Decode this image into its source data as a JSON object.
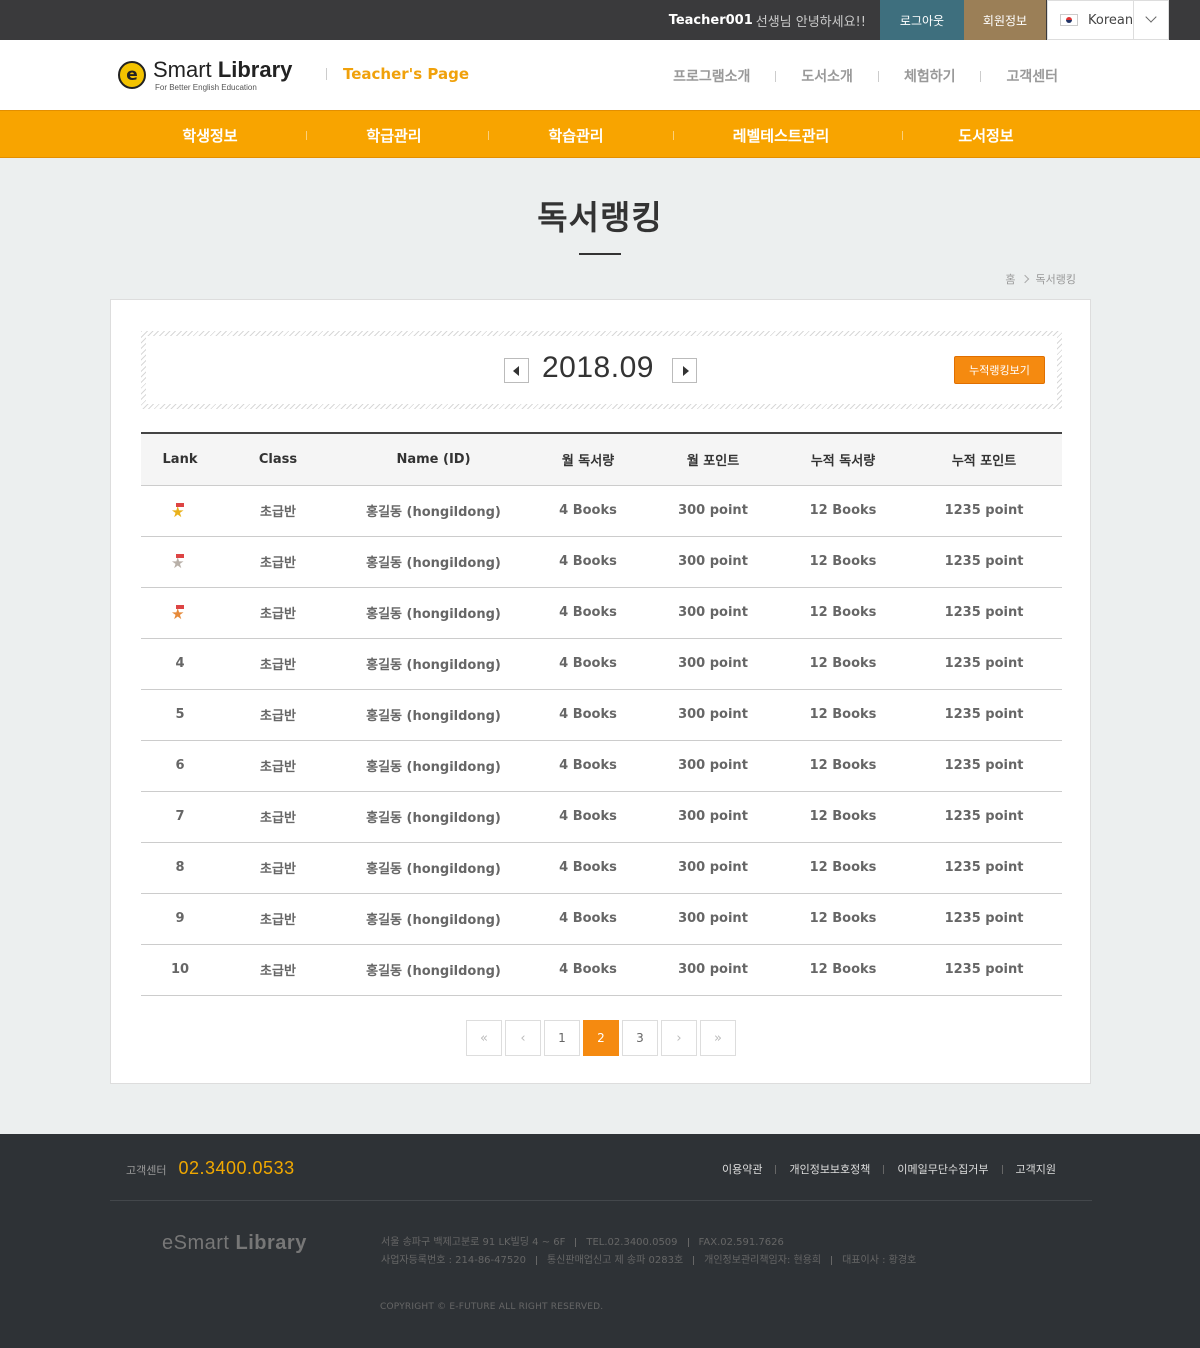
{
  "topbar": {
    "user": "Teacher001",
    "greeting": "선생님 안녕하세요!!",
    "logout": "로그아웃",
    "member_info": "회원정보",
    "language": "Korean"
  },
  "header": {
    "logo_letter": "e",
    "logo_title_light": "Smart",
    "logo_title_bold": "Library",
    "logo_sub": "For Better English Education",
    "teacher_page": "Teacher's Page",
    "gnav": [
      "프로그램소개",
      "도서소개",
      "체험하기",
      "고객센터"
    ]
  },
  "main_nav": [
    "학생정보",
    "학급관리",
    "학습관리",
    "레벨테스트관리",
    "도서정보"
  ],
  "page": {
    "title": "독서랭킹",
    "breadcrumb_home": "홈",
    "breadcrumb_current": "독서랭킹"
  },
  "ranking": {
    "year_month": "2018.09",
    "cumulative_button": "누적랭킹보기",
    "columns": [
      "Lank",
      "Class",
      "Name (ID)",
      "월 독서량",
      "월 포인트",
      "누적 독서량",
      "누적 포인트"
    ],
    "rows": [
      {
        "rank": "",
        "medal": "gold",
        "class": "초급반",
        "name": "홍길동 (hongildong)",
        "month_books": "4 Books",
        "month_points": "300 point",
        "total_books": "12 Books",
        "total_points": "1235 point"
      },
      {
        "rank": "",
        "medal": "silver",
        "class": "초급반",
        "name": "홍길동 (hongildong)",
        "month_books": "4 Books",
        "month_points": "300 point",
        "total_books": "12 Books",
        "total_points": "1235 point"
      },
      {
        "rank": "",
        "medal": "bronze",
        "class": "초급반",
        "name": "홍길동 (hongildong)",
        "month_books": "4 Books",
        "month_points": "300 point",
        "total_books": "12 Books",
        "total_points": "1235 point"
      },
      {
        "rank": "4",
        "medal": "",
        "class": "초급반",
        "name": "홍길동 (hongildong)",
        "month_books": "4 Books",
        "month_points": "300 point",
        "total_books": "12 Books",
        "total_points": "1235 point"
      },
      {
        "rank": "5",
        "medal": "",
        "class": "초급반",
        "name": "홍길동 (hongildong)",
        "month_books": "4 Books",
        "month_points": "300 point",
        "total_books": "12 Books",
        "total_points": "1235 point"
      },
      {
        "rank": "6",
        "medal": "",
        "class": "초급반",
        "name": "홍길동 (hongildong)",
        "month_books": "4 Books",
        "month_points": "300 point",
        "total_books": "12 Books",
        "total_points": "1235 point"
      },
      {
        "rank": "7",
        "medal": "",
        "class": "초급반",
        "name": "홍길동 (hongildong)",
        "month_books": "4 Books",
        "month_points": "300 point",
        "total_books": "12 Books",
        "total_points": "1235 point"
      },
      {
        "rank": "8",
        "medal": "",
        "class": "초급반",
        "name": "홍길동 (hongildong)",
        "month_books": "4 Books",
        "month_points": "300 point",
        "total_books": "12 Books",
        "total_points": "1235 point"
      },
      {
        "rank": "9",
        "medal": "",
        "class": "초급반",
        "name": "홍길동 (hongildong)",
        "month_books": "4 Books",
        "month_points": "300 point",
        "total_books": "12 Books",
        "total_points": "1235 point"
      },
      {
        "rank": "10",
        "medal": "",
        "class": "초급반",
        "name": "홍길동 (hongildong)",
        "month_books": "4 Books",
        "month_points": "300 point",
        "total_books": "12 Books",
        "total_points": "1235 point"
      }
    ]
  },
  "pagination": {
    "first": "«",
    "prev": "‹",
    "pages": [
      "1",
      "2",
      "3"
    ],
    "current": "2",
    "next": "›",
    "last": "»"
  },
  "footer": {
    "cs_label": "고객센터",
    "cs_phone": "02.3400.0533",
    "links": [
      "이용약관",
      "개인정보보호정책",
      "이메일무단수집거부",
      "고객지원"
    ],
    "logo_light": "eSmart",
    "logo_bold": "Library",
    "address": "서울 송파구 백제고분로 91 LK빌딩 4 ~ 6F",
    "tel": "TEL.02.3400.0509",
    "fax": "FAX.02.591.7626",
    "biz_no": "사업자등록번호 : 214-86-47520",
    "mail_order": "통신판매업신고 제 송파 0283호",
    "privacy_officer": "개인정보관리책임자: 현용희",
    "ceo": "대표이사 : 황경호",
    "copyright": "COPYRIGHT © E-FUTURE ALL RIGHT RESERVED."
  },
  "colors": {
    "brand_orange": "#f8a400",
    "accent_orange": "#f58a10",
    "logout_teal": "#3e6f7e",
    "member_brown": "#9b7f57",
    "footer_dark": "#2e3236"
  }
}
